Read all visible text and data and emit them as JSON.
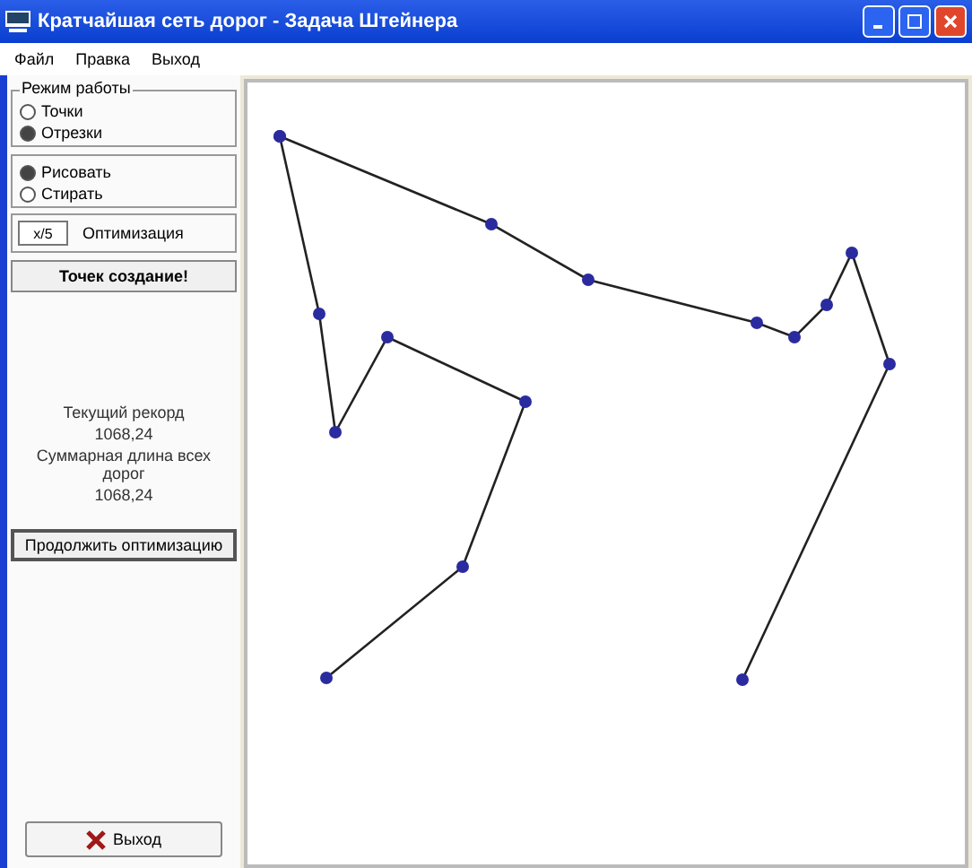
{
  "window": {
    "title": "Кратчайшая сеть дорог - Задача Штейнера"
  },
  "menu": [
    "Файл",
    "Правка",
    "Выход"
  ],
  "mode_group": {
    "title": "Режим работы",
    "options": [
      {
        "label": "Точки",
        "selected": false
      },
      {
        "label": "Отрезки",
        "selected": true
      }
    ]
  },
  "draw_group": {
    "options": [
      {
        "label": "Рисовать",
        "selected": true
      },
      {
        "label": "Стирать",
        "selected": false
      }
    ]
  },
  "count_field": {
    "value": "x/5"
  },
  "optimize_label": "Оптимизация",
  "status_button": "Точек создание!",
  "stats": [
    "Текущий рекорд",
    "1068,24",
    "Суммарная длина всех дорог",
    "1068,24"
  ],
  "continue_button": "Продолжить оптимизацию",
  "exit_button": "Выход"
}
